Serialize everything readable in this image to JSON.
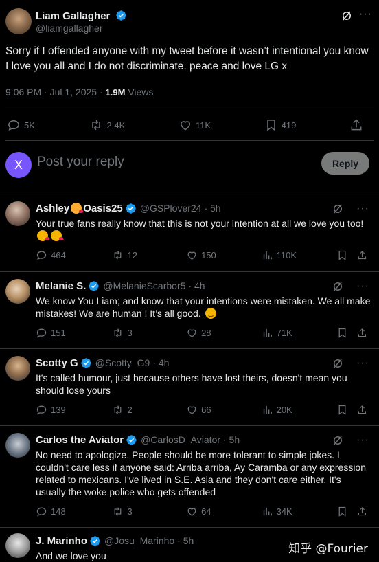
{
  "post": {
    "author_name": "Liam Gallagher",
    "author_handle": "@liamgallagher",
    "text": "Sorry if I offended anyone with my tweet before it wasn’t intentional you know I love you all and I do not discriminate. peace and love LG x",
    "time": "9:06 PM · Jul 1, 2025 · ",
    "views_count": "1.9M",
    "views_label": " Views",
    "replies": "5K",
    "reposts": "2.4K",
    "likes": "11K",
    "bookmarks": "419"
  },
  "composer": {
    "avatar_letter": "X",
    "placeholder": "Post your reply",
    "reply_button": "Reply"
  },
  "replies": [
    {
      "name": "Ashley",
      "name_suffix": "Oasis25",
      "handle": "@GSPlover24",
      "time": "· 5h",
      "text": "Your true fans really know that this is not your intention at all we love you too!",
      "stats": {
        "replies": "464",
        "reposts": "12",
        "likes": "150",
        "views": "110K"
      }
    },
    {
      "name": "Melanie S.",
      "handle": "@MelanieScarbor5",
      "time": "· 4h",
      "text": "We know You Liam; and know that your intentions were mistaken. We all make mistakes! We are human ! It’s all good.",
      "stats": {
        "replies": "151",
        "reposts": "3",
        "likes": "28",
        "views": "71K"
      }
    },
    {
      "name": "Scotty G",
      "handle": "@Scotty_G9",
      "time": "· 4h",
      "text": "It's called humour, just because others have lost theirs, doesn't mean you should lose yours",
      "stats": {
        "replies": "139",
        "reposts": "2",
        "likes": "66",
        "views": "20K"
      }
    },
    {
      "name": "Carlos the Aviator",
      "handle": "@CarlosD_Aviator",
      "time": "· 5h",
      "text": "No need to apologize. People should be more tolerant to simple jokes. I couldn't care less if anyone said: Arriba arriba, Ay Caramba or any expression related to mexicans. I've lived in S.E. Asia and they don't care either. It's usually the woke police who gets offended",
      "stats": {
        "replies": "148",
        "reposts": "3",
        "likes": "64",
        "views": "34K"
      }
    },
    {
      "name": "J. Marinho",
      "handle": "@Josu_Marinho",
      "time": "· 5h",
      "text": "And we love you"
    }
  ],
  "watermark": "知乎 @Fourier",
  "colors": {
    "accent": "#1d9bf0",
    "muted": "#71767b",
    "border": "#2f3336",
    "button_bg": "#787a7a",
    "composer_avatar": "#7856ff"
  }
}
